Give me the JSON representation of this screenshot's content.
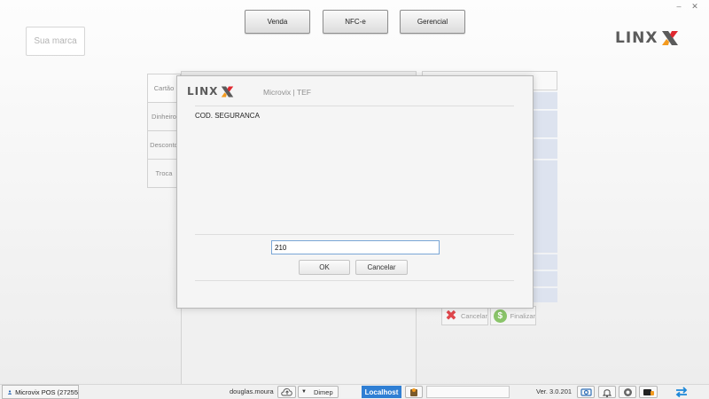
{
  "window": {
    "minimize_glyph": "–",
    "close_glyph": "✕"
  },
  "top_buttons": {
    "venda": "Venda",
    "nfce": "NFC-e",
    "gerencial": "Gerencial"
  },
  "brand_placeholder": "Sua marca",
  "logo": {
    "text": "LINX",
    "icon": "linx-x-icon"
  },
  "side_tabs": [
    "Cartão",
    "Dinheiro",
    "Desconto",
    "Troca"
  ],
  "actions": {
    "cancel": "Cancelar",
    "finalize": "Finalizar"
  },
  "dialog": {
    "title": "Microvix | TEF",
    "prompt": "COD. SEGURANCA",
    "input_value": "210",
    "ok": "OK",
    "cancel": "Cancelar"
  },
  "status_bar": {
    "app_name": "Microvix POS (27255",
    "username": "douglas.moura",
    "printer": "Dimep",
    "server": "Localhost",
    "version": "Ver. 3.0.201"
  },
  "colors": {
    "accent_red": "#e0282f",
    "accent_orange": "#f39a1e",
    "logo_gray": "#5b5b5b",
    "server_blue": "#2f7fd4",
    "sync_blue": "#1e88d8",
    "cancel_red": "#e0474c",
    "finalize_green": "#8ac46a"
  }
}
